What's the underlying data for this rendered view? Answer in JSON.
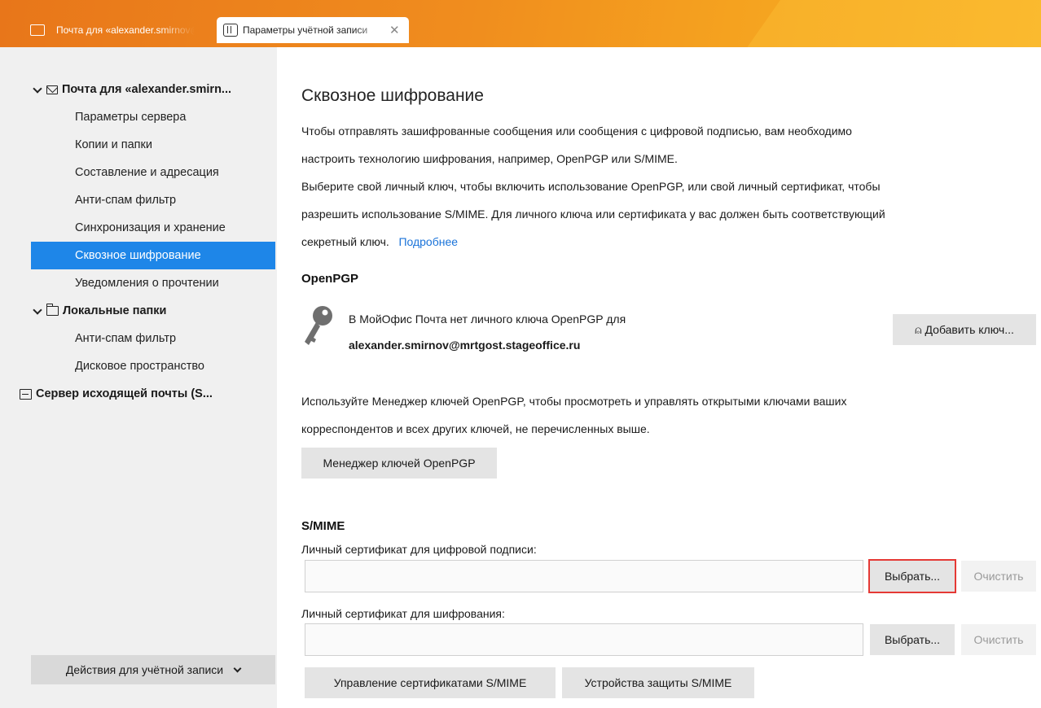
{
  "tabs": [
    {
      "label": "Почта для «alexander.smirnov@mrtgost.stageoffice.ru»",
      "active": false
    },
    {
      "label": "Параметры учётной записи",
      "active": true
    }
  ],
  "sidebar": {
    "accounts": [
      {
        "label": "Почта для «alexander.smirn...",
        "icon": "envelope-icon",
        "expanded": true,
        "items": [
          {
            "label": "Параметры сервера"
          },
          {
            "label": "Копии и папки"
          },
          {
            "label": "Составление и адресация"
          },
          {
            "label": "Анти-спам фильтр"
          },
          {
            "label": "Синхронизация и хранение"
          },
          {
            "label": "Сквозное шифрование",
            "selected": true
          },
          {
            "label": "Уведомления о прочтении"
          }
        ]
      },
      {
        "label": "Локальные папки",
        "icon": "folder-icon",
        "expanded": true,
        "items": [
          {
            "label": "Анти-спам фильтр"
          },
          {
            "label": "Дисковое пространство"
          }
        ]
      }
    ],
    "outgoing_server": "Сервер исходящей почты (S...",
    "account_actions": "Действия для учётной записи"
  },
  "main": {
    "title": "Сквозное шифрование",
    "intro_line1": "Чтобы отправлять зашифрованные сообщения или сообщения с цифровой подписью, вам необходимо",
    "intro_line2": "настроить технологию шифрования, например, OpenPGP или S/MIME.",
    "select_line1": "Выберите свой личный ключ, чтобы включить использование OpenPGP, или свой личный сертификат, чтобы",
    "select_line2": "разрешить использование S/MIME. Для личного ключа или сертификата у вас должен быть соответствующий",
    "select_line3": "секретный ключ.",
    "learn_more": "Подробнее",
    "openpgp": {
      "heading": "OpenPGP",
      "no_key_text": "В МойОфис Почта нет личного ключа OpenPGP для",
      "email": "alexander.smirnov@mrtgost.stageoffice.ru",
      "add_key_button": "Добавить ключ...",
      "manager_info1": "Используйте Менеджер ключей OpenPGP, чтобы просмотреть и управлять открытыми ключами ваших",
      "manager_info2": "корреспондентов и всех других ключей, не перечисленных выше.",
      "manager_button": "Менеджер ключей OpenPGP"
    },
    "smime": {
      "heading": "S/MIME",
      "sign_label": "Личный сертификат для цифровой подписи:",
      "sign_value": "",
      "encrypt_label": "Личный сертификат для шифрования:",
      "encrypt_value": "",
      "select_button": "Выбрать...",
      "clear_button": "Очистить",
      "manage_certs_button": "Управление сертификатами S/MIME",
      "security_devices_button": "Устройства защиты S/MIME"
    }
  },
  "colors": {
    "accent": "#1e86e8",
    "tabbar": "#f08d1e",
    "highlight": "#e53935",
    "link": "#1a73d9"
  }
}
